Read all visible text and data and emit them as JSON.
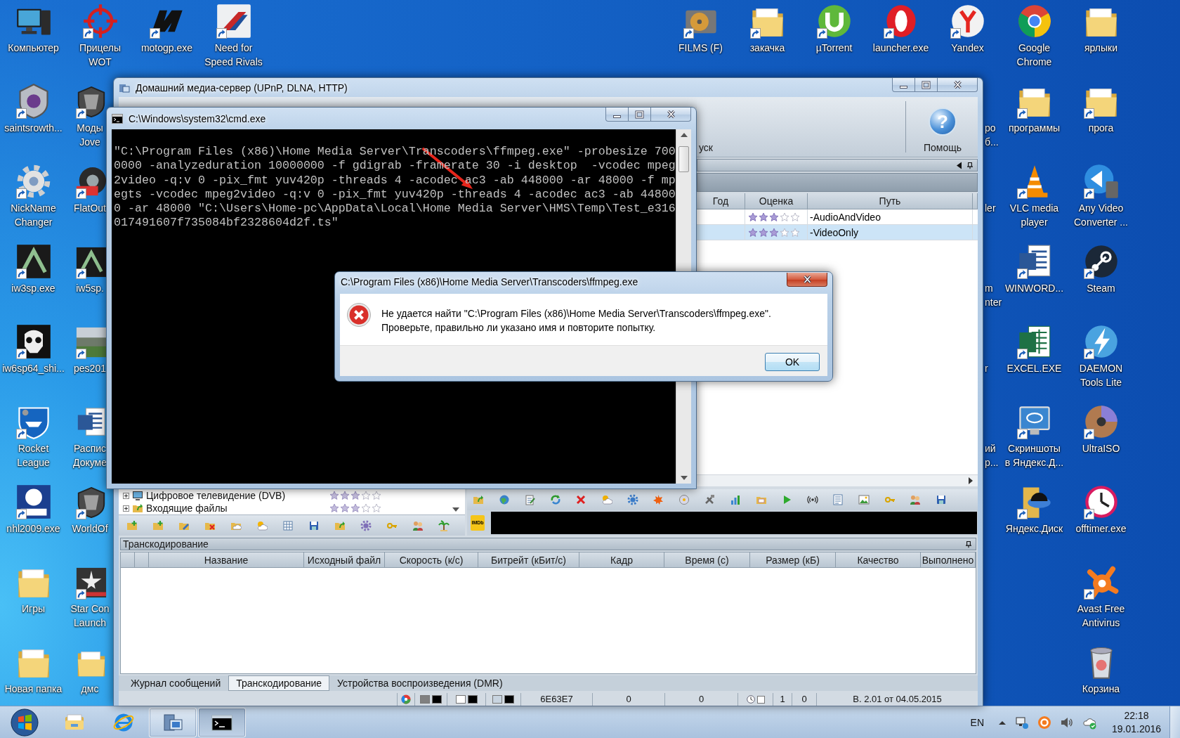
{
  "desktop": {
    "left_columns": [
      {
        "icons": [
          {
            "label": "Компьютер",
            "kind": "computer",
            "shortcut": false
          },
          {
            "label": "saintsrowth...",
            "kind": "emblem",
            "shortcut": true
          },
          {
            "label": "NickName\nChanger",
            "kind": "gear",
            "shortcut": true
          },
          {
            "label": "iw3sp.exe",
            "kind": "game-tile",
            "shortcut": true
          },
          {
            "label": "iw6sp64_shi...",
            "kind": "skull",
            "shortcut": true
          },
          {
            "label": "Rocket\nLeague",
            "kind": "car-shield",
            "shortcut": true
          },
          {
            "label": "nhl2009.exe",
            "kind": "logo-tile",
            "shortcut": true
          },
          {
            "label": "Игры",
            "kind": "folder",
            "shortcut": false
          },
          {
            "label": "Новая папка",
            "kind": "folder",
            "shortcut": false
          }
        ]
      },
      {
        "icons": [
          {
            "label": "Прицелы\nWOT",
            "kind": "crosshair",
            "shortcut": true
          },
          {
            "label": "Моды\nJove",
            "kind": "shield",
            "shortcut": true
          },
          {
            "label": "FlatOut",
            "kind": "wheel",
            "shortcut": true
          },
          {
            "label": "iw5sp.",
            "kind": "game-tile",
            "shortcut": true
          },
          {
            "label": "pes201",
            "kind": "pitch-tile",
            "shortcut": true
          },
          {
            "label": "Распис\nДокуме",
            "kind": "document",
            "shortcut": false
          },
          {
            "label": "WorldOf",
            "kind": "shield",
            "shortcut": true
          },
          {
            "label": "Star Con\nLaunch",
            "kind": "star-tile",
            "shortcut": true
          },
          {
            "label": "дмс",
            "kind": "folder",
            "shortcut": false
          }
        ]
      },
      {
        "icons": [
          {
            "label": "motogp.exe",
            "kind": "stripes",
            "shortcut": true
          }
        ]
      },
      {
        "icons": [
          {
            "label": "Need for\nSpeed Rivals",
            "kind": "racing",
            "shortcut": true
          }
        ]
      }
    ],
    "right_columns": [
      {
        "icons": [
          {
            "label": "FILMS (F)",
            "kind": "hard-drive",
            "shortcut": true
          }
        ]
      },
      {
        "icons": [
          {
            "label": "закачка",
            "kind": "folder",
            "shortcut": true
          }
        ]
      },
      {
        "icons": [
          {
            "label": "µTorrent",
            "kind": "torrent",
            "shortcut": true
          }
        ]
      },
      {
        "icons": [
          {
            "label": "launcher.exe",
            "kind": "ring",
            "shortcut": true
          }
        ]
      },
      {
        "icons": [
          {
            "label": "Yandex",
            "kind": "fork",
            "shortcut": true
          },
          {
            "label": "ро\nб..."
          },
          {
            "label": "ler"
          },
          {
            "label": "m\nnter"
          },
          {
            "label": "r"
          },
          {
            "label": "ий\nр..."
          }
        ]
      },
      {
        "icons": [
          {
            "label": "Google\nChrome",
            "kind": "chrome",
            "shortcut": false
          },
          {
            "label": "программы",
            "kind": "folder",
            "shortcut": true
          },
          {
            "label": "VLC media\nplayer",
            "kind": "cone",
            "shortcut": true
          },
          {
            "label": "WINWORD...",
            "kind": "document",
            "shortcut": true
          },
          {
            "label": "EXCEL.EXE",
            "kind": "spreadsheet",
            "shortcut": true
          },
          {
            "label": "Скриншоты\nв Яндекс.Д...",
            "kind": "monitor",
            "shortcut": true
          },
          {
            "label": "Яндекс.Диск",
            "kind": "cloud-folder",
            "shortcut": true
          }
        ]
      },
      {
        "icons": [
          {
            "label": "ярлыки",
            "kind": "folder",
            "shortcut": false
          },
          {
            "label": "прога",
            "kind": "folder",
            "shortcut": true
          },
          {
            "label": "Any Video\nConverter ...",
            "kind": "converter",
            "shortcut": true
          },
          {
            "label": "Steam",
            "kind": "steam",
            "shortcut": true
          },
          {
            "label": "DAEMON\nTools Lite",
            "kind": "lightning",
            "shortcut": true
          },
          {
            "label": "UltraISO",
            "kind": "disc",
            "shortcut": true
          },
          {
            "label": "offtimer.exe",
            "kind": "clock",
            "shortcut": true
          },
          {
            "label": "Avast Free\nAntivirus",
            "kind": "splat",
            "shortcut": true
          },
          {
            "label": "Корзина",
            "kind": "recycle-bin",
            "shortcut": false
          }
        ]
      }
    ]
  },
  "media_server_window": {
    "title": "Домашний медиа-сервер (UPnP, DLNA, HTTP)",
    "toolbar": {
      "cut_button_label": "уск",
      "help_glyph": "?",
      "help_label": "Помощь"
    },
    "library_table": {
      "columns": [
        "Год",
        "Оценка",
        "Путь"
      ],
      "rows": [
        {
          "stars": 3,
          "path": "-AudioAndVideo",
          "selected": false
        },
        {
          "stars": 3,
          "path": "-VideoOnly",
          "selected": true
        }
      ]
    },
    "tree": [
      {
        "label": "Цифровое телевидение (DVB)",
        "kind": "tv",
        "expanded": false,
        "stars": 3
      },
      {
        "label": "Входящие файлы",
        "kind": "folder",
        "expanded": false,
        "stars": 3
      }
    ],
    "imdb_label": "IMDb",
    "transcoding_panel": {
      "title": "Транскодирование",
      "columns": [
        "Название",
        "Исходный файл",
        "Скорость (к/с)",
        "Битрейт (кБит/с)",
        "Кадр",
        "Время (с)",
        "Размер (кБ)",
        "Качество",
        "Выполнено"
      ]
    },
    "tabs": [
      {
        "label": "Журнал сообщений",
        "selected": false
      },
      {
        "label": "Транскодирование",
        "selected": true
      },
      {
        "label": "Устройства воспроизведения (DMR)",
        "selected": false
      }
    ],
    "status_bar": {
      "segments": [
        {
          "kind": "palette"
        },
        {
          "kind": "swatches",
          "swatches": [
            {
              "color": "#808080"
            },
            {
              "color": "#000000"
            }
          ]
        },
        {
          "kind": "swatches",
          "swatches": [
            {
              "color": "#ffffff"
            },
            {
              "color": "#000000"
            }
          ]
        },
        {
          "kind": "swatches",
          "swatches": [
            {
              "color": "#c8d4e0"
            },
            {
              "color": "#000000"
            }
          ]
        },
        {
          "kind": "text",
          "text": "6E63E7"
        },
        {
          "kind": "text",
          "text": "0"
        },
        {
          "kind": "text",
          "text": "0"
        },
        {
          "kind": "clock",
          "checked": false
        },
        {
          "kind": "text",
          "text": "1"
        },
        {
          "kind": "text",
          "text": "0"
        },
        {
          "kind": "text",
          "text": "В. 2.01 от 04.05.2015"
        }
      ]
    }
  },
  "console_window": {
    "title": "C:\\Windows\\system32\\cmd.exe",
    "output_lines": [
      "\"C:\\Program Files (x86)\\Home Media Server\\Transcoders\\ffmpeg.exe\" -probesize 700",
      "0000 -analyzeduration 10000000 -f gdigrab -framerate 30 -i desktop  -vcodec mpeg",
      "2video -q:v 0 -pix_fmt yuv420p -threads 4 -acodec ac3 -ab 448000 -ar 48000 -f mp",
      "egts -vcodec mpeg2video -q:v 0 -pix_fmt yuv420p -threads 4 -acodec ac3 -ab 44800",
      "0 -ar 48000 \"C:\\Users\\Home-pc\\AppData\\Local\\Home Media Server\\HMS\\Temp\\Test_e316",
      "017491607f735084bf2328604d2f.ts\""
    ]
  },
  "error_dialog": {
    "title": "C:\\Program Files (x86)\\Home Media Server\\Transcoders\\ffmpeg.exe",
    "message": "Не удается найти \"C:\\Program Files (x86)\\Home Media Server\\Transcoders\\ffmpeg.exe\".\nПроверьте, правильно ли указано имя и повторите попытку.",
    "buttons": [
      "OK"
    ]
  },
  "taskbar": {
    "buttons": [
      {
        "kind": "explorer",
        "running": false,
        "selected": false
      },
      {
        "kind": "browser",
        "running": false,
        "selected": false
      },
      {
        "kind": "media-server",
        "running": true,
        "selected": false
      },
      {
        "kind": "console",
        "running": true,
        "selected": true
      }
    ],
    "language": "EN",
    "time": "22:18",
    "date": "19.01.2016"
  }
}
